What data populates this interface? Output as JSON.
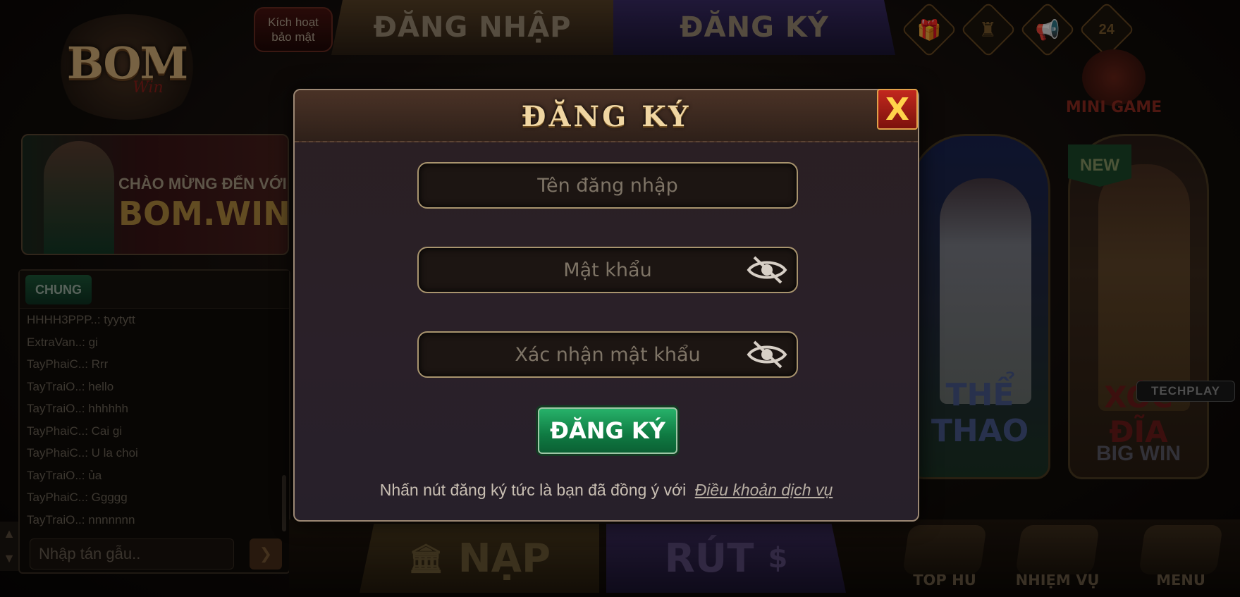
{
  "header": {
    "security_label_line1": "Kích hoạt",
    "security_label_line2": "bảo mật",
    "tab_login": "ĐĂNG NHẬP",
    "tab_register": "ĐĂNG KÝ",
    "badge_24": "24",
    "icons": [
      "gift-icon",
      "leaderboard-icon",
      "megaphone-icon",
      "support-24-icon"
    ]
  },
  "logo": {
    "main": "BOM",
    "sub": "Win"
  },
  "minigame": {
    "label": "MINI GAME"
  },
  "banner": {
    "line1": "CHÀO MỪNG ĐẾN VỚI",
    "line2": "BOM.WIN"
  },
  "chat": {
    "tab": "CHUNG",
    "messages": [
      {
        "user": "HHHH3PPP..",
        "text": "tyytytt"
      },
      {
        "user": "ExtraVan..",
        "text": "gi"
      },
      {
        "user": "TayPhaiC..",
        "text": "Rrr"
      },
      {
        "user": "TayTraiO..",
        "text": "hello"
      },
      {
        "user": "TayTraiO..",
        "text": "hhhhhh"
      },
      {
        "user": "TayPhaiC..",
        "text": "Cai gi"
      },
      {
        "user": "TayPhaiC..",
        "text": "U la choi"
      },
      {
        "user": "TayTraiO..",
        "text": "ủa"
      },
      {
        "user": "TayPhaiC..",
        "text": "Ggggg"
      },
      {
        "user": "TayTraiO..",
        "text": "nnnnnnn"
      }
    ],
    "input_placeholder": "Nhập tán gẫu.."
  },
  "cards": {
    "sport_label": "THỂ THAO",
    "new_badge": "NEW",
    "xoc_label": "XÓC ĐĨA",
    "xoc_sub": "BIG WIN",
    "techplay": "TECHPLAY"
  },
  "bottom": {
    "deposit": "NẠP",
    "withdraw": "RÚT",
    "top_hu": "TOP HŨ",
    "nhiem_vu": "NHIỆM VỤ",
    "menu": "MENU"
  },
  "modal": {
    "title": "ĐĂNG KÝ",
    "close": "X",
    "username_placeholder": "Tên đăng nhập",
    "password_placeholder": "Mật khẩu",
    "confirm_placeholder": "Xác nhận mật khẩu",
    "submit": "ĐĂNG KÝ",
    "terms_text": "Nhấn nút đăng ký tức là bạn đã đồng ý với",
    "terms_link": "Điều khoản dịch vụ"
  },
  "colors": {
    "modal_border": "#9c8874",
    "title_gold": "#f0d6a2",
    "submit_green": "#1a9a58",
    "close_red": "#c2281e"
  }
}
